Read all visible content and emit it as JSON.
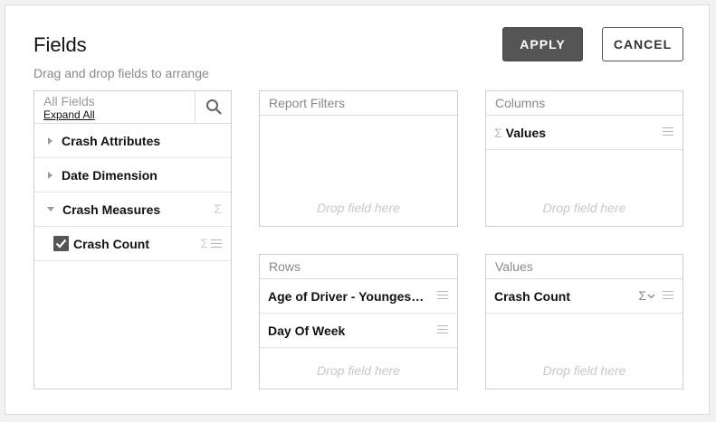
{
  "dialog": {
    "title": "Fields",
    "subtitle": "Drag and drop fields to arrange",
    "apply_label": "APPLY",
    "cancel_label": "CANCEL"
  },
  "all_fields": {
    "title": "All Fields",
    "expand_all": "Expand All",
    "items": [
      {
        "label": "Crash Attributes",
        "state": "collapsed"
      },
      {
        "label": "Date Dimension",
        "state": "collapsed"
      },
      {
        "label": "Crash Measures",
        "state": "expanded",
        "icon": "sigma-icon"
      },
      {
        "label": "Crash Count",
        "checked": true,
        "icon": "sigma-icon"
      }
    ]
  },
  "report_filters": {
    "title": "Report Filters",
    "drop_hint": "Drop field here"
  },
  "columns": {
    "title": "Columns",
    "items": [
      {
        "label": "Values",
        "icon": "sigma-icon"
      }
    ],
    "drop_hint": "Drop field here"
  },
  "rows": {
    "title": "Rows",
    "items": [
      {
        "label": "Age of Driver - Youngest Driver"
      },
      {
        "label": "Day Of Week"
      }
    ],
    "drop_hint": "Drop field here"
  },
  "values": {
    "title": "Values",
    "items": [
      {
        "label": "Crash Count",
        "icon": "sigma-dropdown-icon"
      }
    ],
    "drop_hint": "Drop field here"
  }
}
